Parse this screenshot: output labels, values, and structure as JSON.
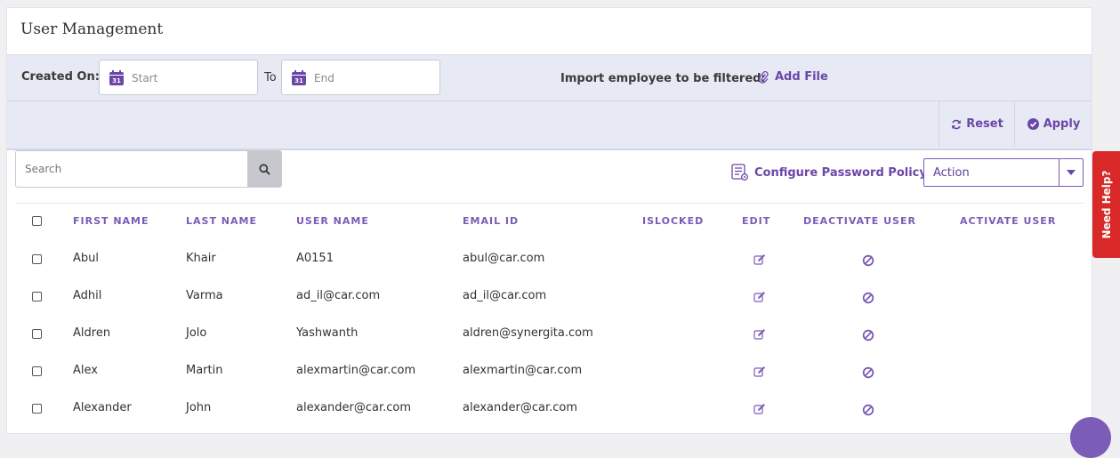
{
  "page": {
    "title": "User Management"
  },
  "filters": {
    "created_on_label": "Created On:",
    "start_placeholder": "Start",
    "to_label": "To",
    "end_placeholder": "End",
    "calendar_day": "31",
    "import_label": "Import employee to be filtered:",
    "add_file_label": "Add File",
    "reset_label": "Reset",
    "apply_label": "Apply"
  },
  "toolbar": {
    "search_placeholder": "Search",
    "configure_password_policy": "Configure Password Policy",
    "action_value": "Action"
  },
  "table": {
    "columns": [
      "FIRST NAME",
      "LAST NAME",
      "USER NAME",
      "EMAIL ID",
      "ISLOCKED",
      "EDIT",
      "DEACTIVATE USER",
      "ACTIVATE USER"
    ],
    "rows": [
      {
        "first": "Abul",
        "last": "Khair",
        "username": "A0151",
        "email": "abul@car.com"
      },
      {
        "first": "Adhil",
        "last": "Varma",
        "username": "ad_il@car.com",
        "email": "ad_il@car.com"
      },
      {
        "first": "Aldren",
        "last": "Jolo",
        "username": "Yashwanth",
        "email": "aldren@synergita.com"
      },
      {
        "first": "Alex",
        "last": "Martin",
        "username": "alexmartin@car.com",
        "email": "alexmartin@car.com"
      },
      {
        "first": "Alexander",
        "last": "John",
        "username": "alexander@car.com",
        "email": "alexander@car.com"
      }
    ]
  },
  "help": {
    "label": "Need Help?"
  },
  "icons": {
    "calendar": "calendar-icon",
    "paperclip": "paperclip-icon",
    "refresh": "refresh-icon",
    "check_circle": "check-circle-icon",
    "search": "search-icon",
    "config": "config-list-icon",
    "caret": "caret-down-icon",
    "edit": "edit-icon",
    "deactivate": "ban-icon"
  },
  "colors": {
    "accent": "#6b46a8",
    "header": "#7b5cb6",
    "filter_bg": "#e7eaf4",
    "help": "#d92828"
  }
}
